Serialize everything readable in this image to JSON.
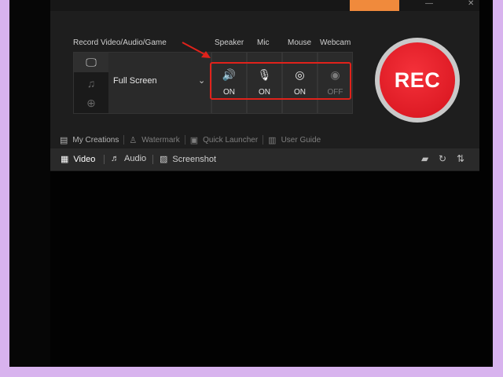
{
  "colors": {
    "frame": "#d8b3ee",
    "app_background": "#1e1e1e",
    "rec_button": "#e51f28",
    "highlight": "#e0221b",
    "accent_tab": "#f08a3c"
  },
  "window": {
    "controls": [
      "—",
      "✕"
    ]
  },
  "recorder": {
    "record_label": "Record Video/Audio/Game",
    "mode_icons": [
      "monitor-icon",
      "music-note-icon",
      "gamepad-icon"
    ],
    "mode_value": "Full Screen",
    "mode_chevron": "⌄"
  },
  "devices": [
    {
      "label": "Speaker",
      "state": "ON",
      "icon": "speaker-icon",
      "glyph": "🔊"
    },
    {
      "label": "Mic",
      "state": "ON",
      "icon": "microphone-icon",
      "glyph": "🎙"
    },
    {
      "label": "Mouse",
      "state": "ON",
      "icon": "mouse-cursor-icon",
      "glyph": "◎"
    },
    {
      "label": "Webcam",
      "state": "OFF",
      "icon": "webcam-icon",
      "glyph": "◉"
    }
  ],
  "rec_button": {
    "label": "REC"
  },
  "links": [
    {
      "label": "My Creations",
      "icon": "creations-icon"
    },
    {
      "label": "Watermark",
      "icon": "watermark-icon"
    },
    {
      "label": "Quick Launcher",
      "icon": "launcher-icon"
    },
    {
      "label": "User Guide",
      "icon": "guide-icon"
    }
  ],
  "tabs": [
    {
      "label": "Video",
      "icon": "film-icon",
      "active": true
    },
    {
      "label": "Audio",
      "icon": "audio-icon",
      "active": false
    },
    {
      "label": "Screenshot",
      "icon": "image-icon",
      "active": false
    }
  ],
  "toolbar_icons": [
    "folder-icon",
    "refresh-icon",
    "sort-icon"
  ]
}
